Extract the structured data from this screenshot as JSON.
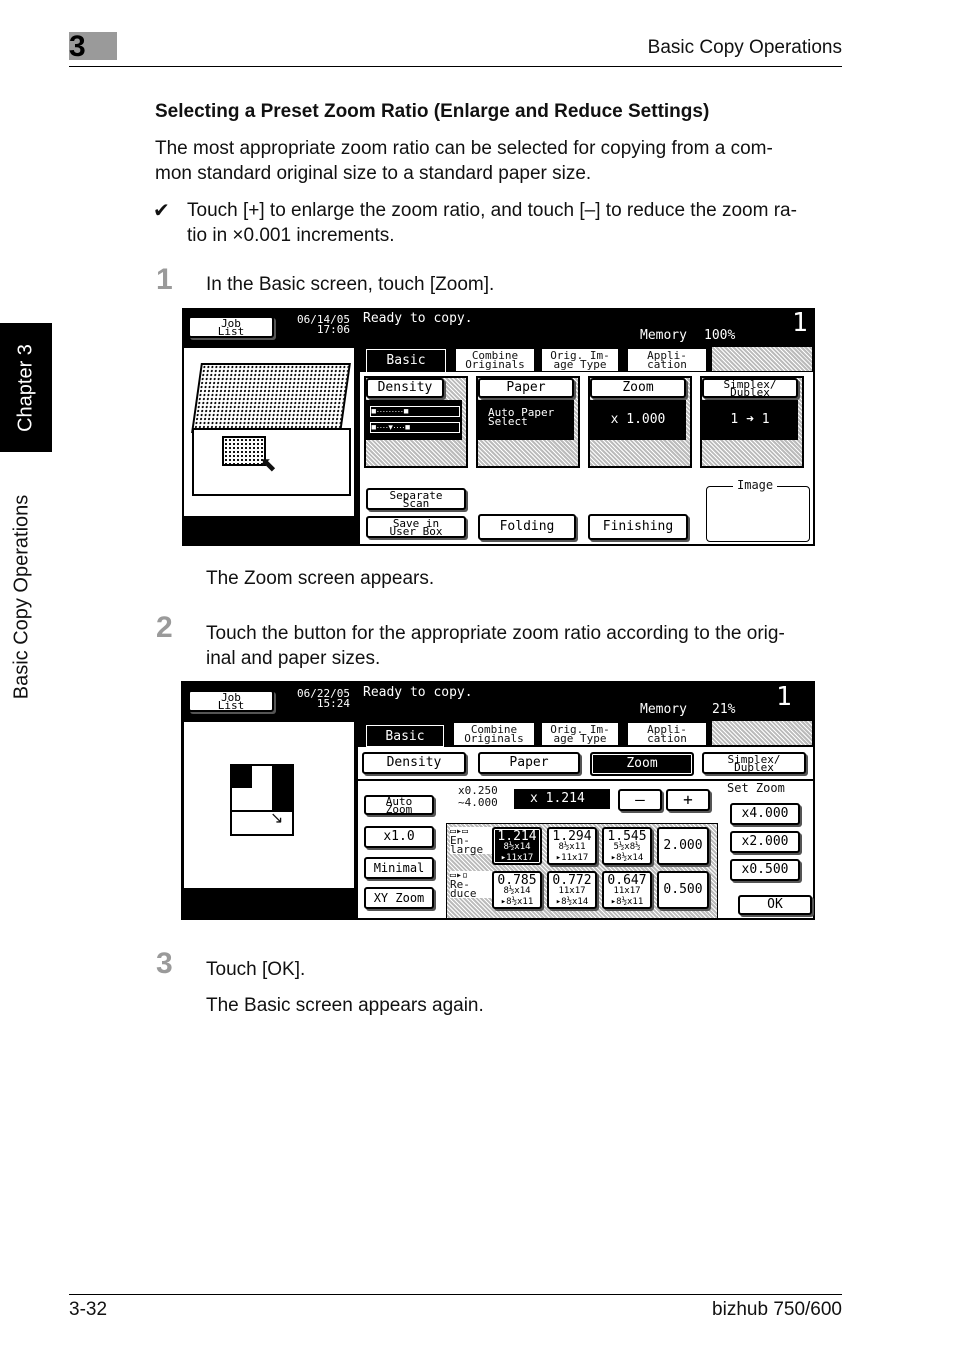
{
  "header": {
    "chapter_number": "3",
    "section_title": "Basic Copy Operations"
  },
  "side": {
    "tab_label": "Chapter 3",
    "section_label": "Basic Copy Operations"
  },
  "heading": "Selecting a Preset Zoom Ratio (Enlarge and Reduce Settings)",
  "intro_lines": [
    "The most appropriate zoom ratio can be selected for copying from a com-",
    "mon standard original size to a standard paper size."
  ],
  "note": {
    "icon": "checkmark-icon",
    "lines": [
      "Touch [+] to enlarge the zoom ratio, and touch [–] to reduce the zoom ra-",
      "tio in ×0.001 increments."
    ]
  },
  "steps": [
    {
      "number": "1",
      "lines": [
        "In the Basic screen, touch [Zoom]."
      ],
      "result": "The Zoom screen appears."
    },
    {
      "number": "2",
      "lines": [
        "Touch the button for the appropriate zoom ratio according to the orig-",
        "inal and paper sizes."
      ]
    },
    {
      "number": "3",
      "lines": [
        "Touch [OK]."
      ],
      "result": "The Basic screen appears again."
    }
  ],
  "screen1": {
    "job_list": [
      "Job",
      "List"
    ],
    "date": "06/14/05",
    "time": "17:06",
    "status": "Ready to copy.",
    "memory_label": "Memory",
    "memory_value": "100%",
    "copies": "1",
    "tabs": [
      {
        "lines": [
          "Basic"
        ]
      },
      {
        "lines": [
          "Combine",
          "Originals"
        ]
      },
      {
        "lines": [
          "Orig. Im-",
          "age Type"
        ]
      },
      {
        "lines": [
          "Appli-",
          "cation"
        ]
      }
    ],
    "functions": [
      {
        "title": "Density",
        "value": ""
      },
      {
        "title": "Paper",
        "value_lines": [
          "Auto Paper",
          "Select"
        ]
      },
      {
        "title": "Zoom",
        "value": "x 1.000"
      },
      {
        "title_lines": [
          "Simplex/",
          "Duplex"
        ],
        "value": "1 ➜ 1"
      }
    ],
    "buttons": [
      {
        "lines": [
          "Separate",
          "Scan"
        ]
      },
      {
        "lines": [
          "Save in",
          "User Box"
        ]
      },
      {
        "lines": [
          "Folding"
        ]
      },
      {
        "lines": [
          "Finishing"
        ]
      }
    ],
    "image_label": "Image"
  },
  "screen2": {
    "job_list": [
      "Job",
      "List"
    ],
    "date": "06/22/05",
    "time": "15:24",
    "status": "Ready to copy.",
    "memory_label": "Memory",
    "memory_value": "21%",
    "copies": "1",
    "tabs": [
      {
        "lines": [
          "Basic"
        ]
      },
      {
        "lines": [
          "Combine",
          "Originals"
        ]
      },
      {
        "lines": [
          "Orig. Im-",
          "age Type"
        ]
      },
      {
        "lines": [
          "Appli-",
          "cation"
        ]
      }
    ],
    "subtabs": [
      "Density",
      "Paper",
      "Zoom",
      [
        "Simplex/",
        "Duplex"
      ]
    ],
    "range": [
      "x0.250",
      "~4.000"
    ],
    "current_zoom": "x 1.214",
    "minus_label": "–",
    "plus_label": "+",
    "left_buttons": [
      {
        "lines": [
          "Auto",
          "Zoom"
        ]
      },
      {
        "lines": [
          "x1.0"
        ]
      },
      {
        "lines": [
          "Minimal"
        ]
      },
      {
        "lines": [
          "XY Zoom"
        ]
      }
    ],
    "enlarge_label": [
      "En-",
      "large"
    ],
    "reduce_label": [
      "Re-",
      "duce"
    ],
    "enlarge": [
      {
        "ratio": "1.214",
        "s1": "8½x14",
        "s2": "▸11x17"
      },
      {
        "ratio": "1.294",
        "s1": "8½x11",
        "s2": "▸11x17"
      },
      {
        "ratio": "1.545",
        "s1": "5½x8½",
        "s2": "▸8½x14"
      },
      {
        "ratio": "2.000"
      }
    ],
    "reduce": [
      {
        "ratio": "0.785",
        "s1": "8½x14",
        "s2": "▸8½x11"
      },
      {
        "ratio": "0.772",
        "s1": "11x17",
        "s2": "▸8½x14"
      },
      {
        "ratio": "0.647",
        "s1": "11x17",
        "s2": "▸8½x11"
      },
      {
        "ratio": "0.500"
      }
    ],
    "set_zoom_label": "Set Zoom",
    "set_zoom": [
      "x4.000",
      "x2.000",
      "x0.500"
    ],
    "ok_label": "OK"
  },
  "footer": {
    "page": "3-32",
    "product": "bizhub 750/600"
  }
}
